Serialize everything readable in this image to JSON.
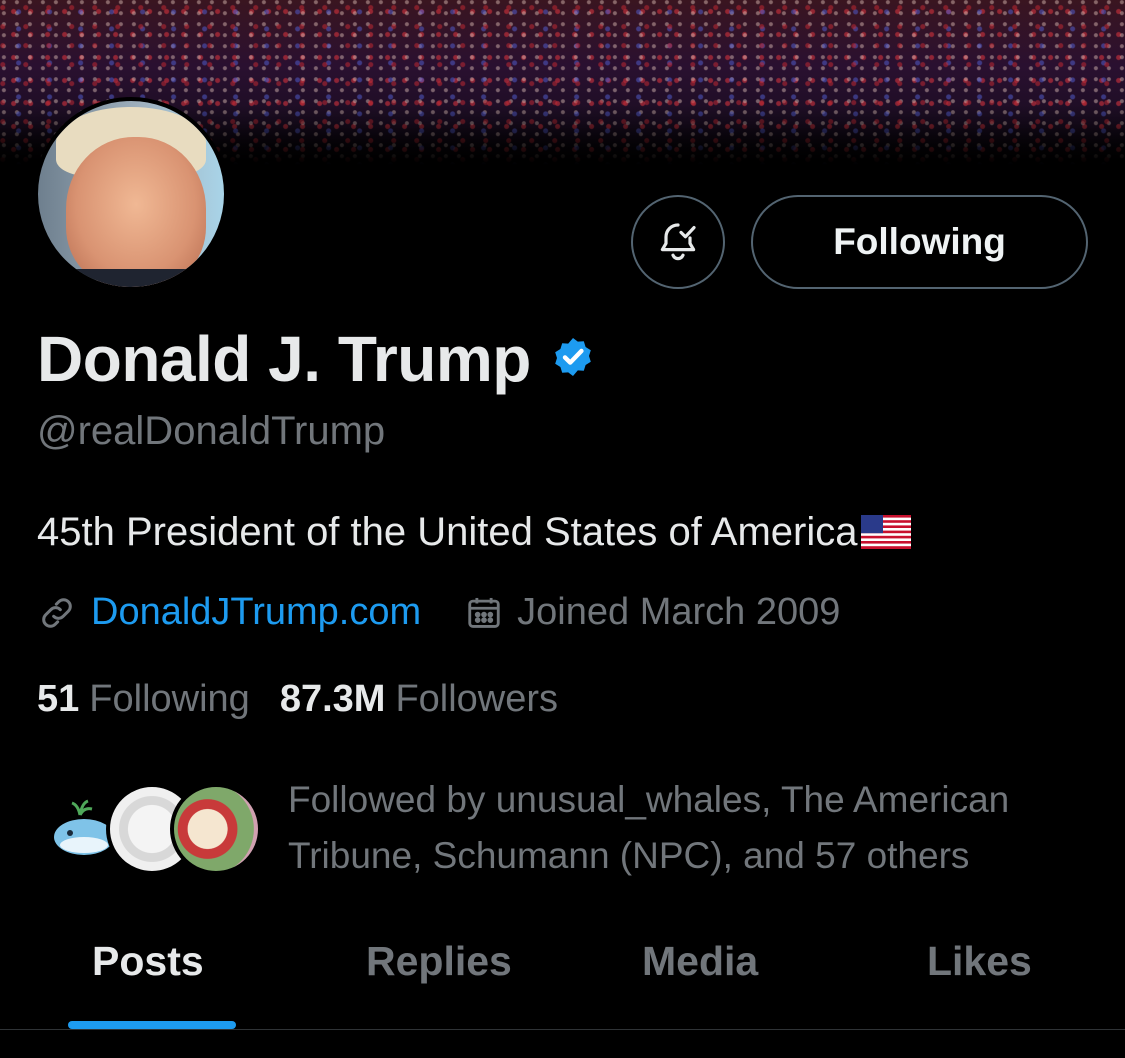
{
  "profile": {
    "name": "Donald J. Trump",
    "handle": "@realDonaldTrump",
    "bio": "45th President of the United States of America",
    "website": "DonaldJTrump.com",
    "joined": "Joined March 2009",
    "following_count": "51",
    "following_label": "Following",
    "followers_count": "87.3M",
    "followers_label": "Followers",
    "followed_by": "Followed by unusual_whales, The American Tribune, Schumann (NPC), and 57 others"
  },
  "actions": {
    "follow_button_label": "Following",
    "notification_icon": "bell-check-icon"
  },
  "tabs": [
    {
      "label": "Posts",
      "active": true
    },
    {
      "label": "Replies",
      "active": false
    },
    {
      "label": "Media",
      "active": false
    },
    {
      "label": "Likes",
      "active": false
    }
  ],
  "colors": {
    "background": "#000000",
    "accent": "#1d9bf0",
    "muted_text": "#71767b",
    "primary_text": "#e7e9ea"
  }
}
